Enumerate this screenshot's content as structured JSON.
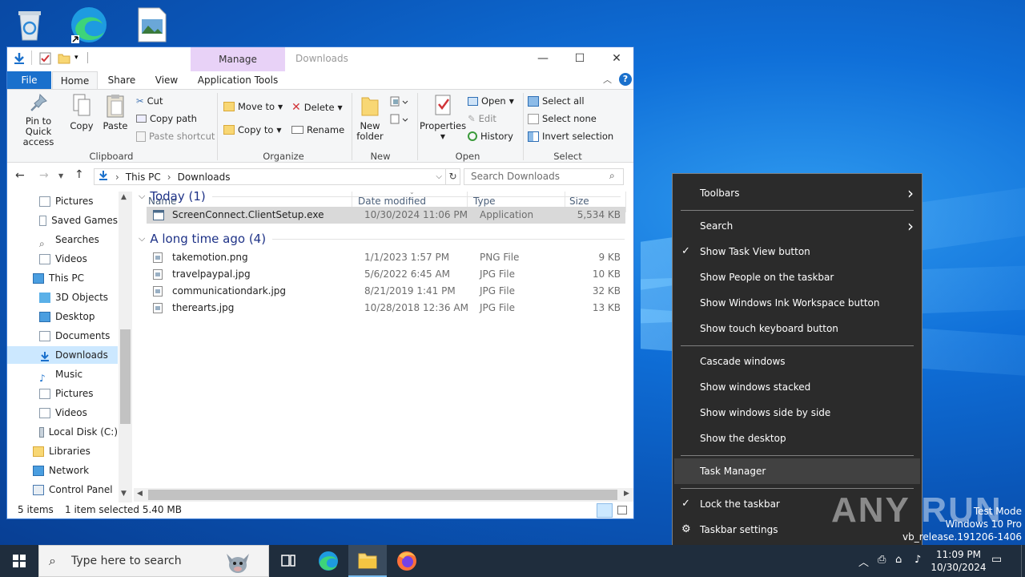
{
  "window": {
    "title": "Downloads",
    "manage_tab": "Manage",
    "minimize": "—",
    "maximize": "☐",
    "close": "✕",
    "help": "?"
  },
  "ribbon_tabs": [
    "File",
    "Home",
    "Share",
    "View",
    "Application Tools"
  ],
  "ribbon": {
    "clipboard": {
      "pin": "Pin to Quick access",
      "copy": "Copy",
      "paste": "Paste",
      "cut": "Cut",
      "copy_path": "Copy path",
      "paste_shortcut": "Paste shortcut",
      "label": "Clipboard"
    },
    "organize": {
      "move_to": "Move to",
      "delete": "Delete",
      "copy_to": "Copy to",
      "rename": "Rename",
      "label": "Organize"
    },
    "new": {
      "new_folder": "New folder",
      "label": "New"
    },
    "open": {
      "properties": "Properties",
      "open": "Open",
      "edit": "Edit",
      "history": "History",
      "label": "Open"
    },
    "select": {
      "select_all": "Select all",
      "select_none": "Select none",
      "invert": "Invert selection",
      "label": "Select"
    }
  },
  "address": {
    "crumbs": [
      "This PC",
      "Downloads"
    ],
    "search_placeholder": "Search Downloads"
  },
  "nav": [
    {
      "label": "Pictures",
      "icon": "pictures-icon"
    },
    {
      "label": "Saved Games",
      "icon": "saved-games-icon"
    },
    {
      "label": "Searches",
      "icon": "search-icon"
    },
    {
      "label": "Videos",
      "icon": "videos-icon"
    },
    {
      "label": "This PC",
      "icon": "pc-icon"
    },
    {
      "label": "3D Objects",
      "icon": "3d-objects-icon"
    },
    {
      "label": "Desktop",
      "icon": "desktop-icon"
    },
    {
      "label": "Documents",
      "icon": "documents-icon"
    },
    {
      "label": "Downloads",
      "icon": "downloads-icon"
    },
    {
      "label": "Music",
      "icon": "music-icon"
    },
    {
      "label": "Pictures",
      "icon": "pictures-icon"
    },
    {
      "label": "Videos",
      "icon": "videos-icon"
    },
    {
      "label": "Local Disk (C:)",
      "icon": "disk-icon"
    },
    {
      "label": "Libraries",
      "icon": "libraries-icon"
    },
    {
      "label": "Network",
      "icon": "network-icon"
    },
    {
      "label": "Control Panel",
      "icon": "control-panel-icon"
    }
  ],
  "columns": [
    "Name",
    "Date modified",
    "Type",
    "Size"
  ],
  "groups": [
    {
      "label": "Today (1)",
      "files": [
        {
          "name": "ScreenConnect.ClientSetup.exe",
          "date": "10/30/2024 11:06 PM",
          "type": "Application",
          "size": "5,534 KB",
          "selected": true
        }
      ]
    },
    {
      "label": "A long time ago (4)",
      "files": [
        {
          "name": "takemotion.png",
          "date": "1/1/2023 1:57 PM",
          "type": "PNG File",
          "size": "9 KB"
        },
        {
          "name": "travelpaypal.jpg",
          "date": "5/6/2022 6:45 AM",
          "type": "JPG File",
          "size": "10 KB"
        },
        {
          "name": "communicationdark.jpg",
          "date": "8/21/2019 1:41 PM",
          "type": "JPG File",
          "size": "32 KB"
        },
        {
          "name": "therearts.jpg",
          "date": "10/28/2018 12:36 AM",
          "type": "JPG File",
          "size": "13 KB"
        }
      ]
    }
  ],
  "status": {
    "items": "5 items",
    "selected": "1 item selected  5.40 MB"
  },
  "context_menu": [
    {
      "label": "Toolbars",
      "submenu": true
    },
    {
      "label": "Search",
      "submenu": true
    },
    {
      "label": "Show Task View button",
      "checked": true
    },
    {
      "label": "Show People on the taskbar"
    },
    {
      "label": "Show Windows Ink Workspace button"
    },
    {
      "label": "Show touch keyboard button"
    },
    {
      "label": "Cascade windows"
    },
    {
      "label": "Show windows stacked"
    },
    {
      "label": "Show windows side by side"
    },
    {
      "label": "Show the desktop"
    },
    {
      "label": "Task Manager",
      "highlighted": true
    },
    {
      "label": "Lock the taskbar",
      "checked": true
    },
    {
      "label": "Taskbar settings",
      "gear": true
    }
  ],
  "taskbar": {
    "search_placeholder": "Type here to search",
    "time": "11:09 PM",
    "date": "10/30/2024"
  },
  "watermark": {
    "brand": "ANY RUN",
    "line1": "Test Mode",
    "line2": "Windows 10 Pro",
    "line3": "vb_release.191206-1406"
  },
  "colors": {
    "accent": "#1a70cc",
    "menu_bg": "#2b2b2b",
    "taskbar": "#1f2d3d",
    "selection": "#cce8ff"
  }
}
